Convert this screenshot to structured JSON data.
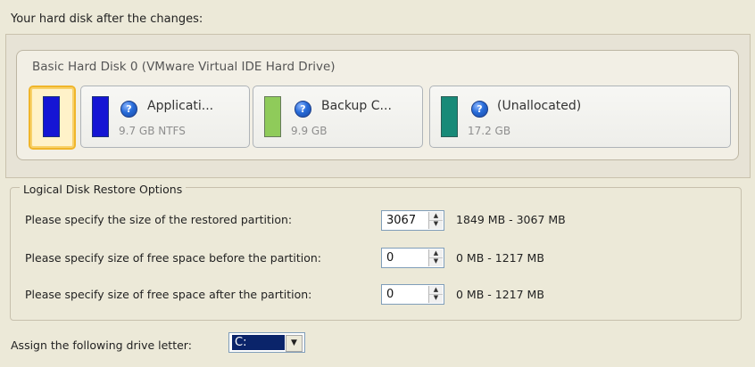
{
  "header": {
    "title": "Your hard disk after the changes:"
  },
  "disk": {
    "label": "Basic Hard Disk 0 (VMware Virtual IDE Hard Drive)"
  },
  "partitions": [
    {
      "name": "Applicati...",
      "size": "9.7 GB NTFS"
    },
    {
      "name": "Backup C...",
      "size": "9.9 GB"
    },
    {
      "name": "(Unallocated)",
      "size": "17.2 GB"
    }
  ],
  "options": {
    "group_title": "Logical Disk Restore Options",
    "rows": [
      {
        "label": "Please specify the size of the restored partition:",
        "value": "3067",
        "range": "1849 MB - 3067 MB"
      },
      {
        "label": "Please specify size of free space before the partition:",
        "value": "0",
        "range": "0 MB - 1217 MB"
      },
      {
        "label": "Please specify size of free space after the partition:",
        "value": "0",
        "range": "0 MB - 1217 MB"
      }
    ]
  },
  "drive_letter": {
    "label": "Assign the following drive letter:",
    "value": "C:"
  },
  "icons": {
    "help": "help-icon",
    "spin_up": "spin-up-icon",
    "spin_down": "spin-down-icon",
    "dropdown": "chevron-down-icon"
  },
  "colors": {
    "selected_border": "#f0b52a",
    "partition_blue": "#1515d4",
    "partition_green": "#8fcb5a",
    "partition_teal": "#188a78",
    "selection_blue": "#0a246a"
  }
}
